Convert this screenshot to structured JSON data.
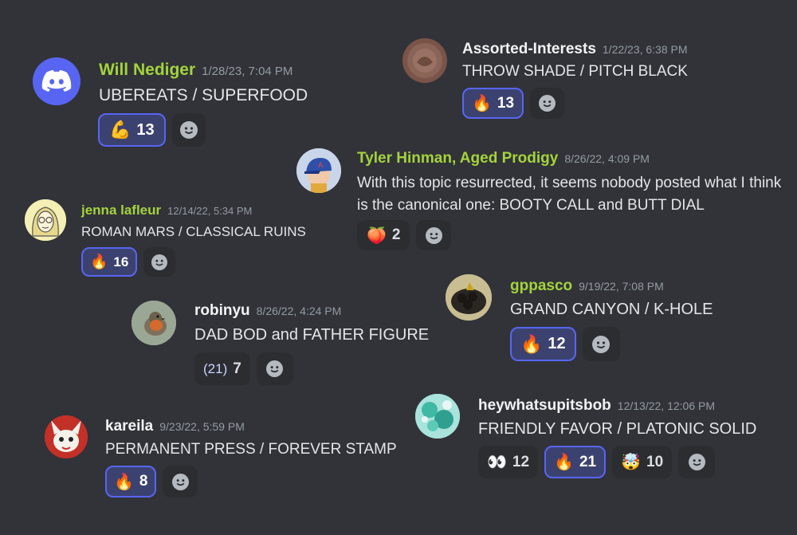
{
  "colors": {
    "background": "#313338",
    "name_green": "#a4d33c",
    "name_white": "#f2f3f5",
    "timestamp": "#949ba4",
    "reaction_me_border": "#5865f2",
    "reaction_me_bg": "#3c4270",
    "reaction_bg": "#2b2d31"
  },
  "messages": [
    {
      "id": "will",
      "author": "Will Nediger",
      "timestamp": "1/28/23, 7:04 PM",
      "text": "UBEREATS / SUPERFOOD",
      "avatar": "discord-logo-icon",
      "reactions": [
        {
          "emoji": "💪",
          "icon": "flexed-biceps-icon",
          "count": "13",
          "me": true
        }
      ]
    },
    {
      "id": "assorted",
      "author": "Assorted-Interests",
      "timestamp": "1/22/23, 6:38 PM",
      "text": "THROW SHADE / PITCH BLACK",
      "avatar": "coin-avatar",
      "reactions": [
        {
          "emoji": "🔥",
          "icon": "fire-icon",
          "count": "13",
          "me": true
        }
      ]
    },
    {
      "id": "tyler",
      "author": "Tyler Hinman, Aged Prodigy",
      "timestamp": "8/26/22, 4:09 PM",
      "text": "With this topic resurrected, it seems nobody posted what I think is the canonical one: BOOTY CALL and BUTT DIAL",
      "avatar": "baseball-cap-avatar",
      "reactions": [
        {
          "emoji": "🍑",
          "icon": "peach-icon",
          "count": "2",
          "me": false
        }
      ]
    },
    {
      "id": "jenna",
      "author": "jenna lafleur",
      "timestamp": "12/14/22, 5:34 PM",
      "text": "ROMAN MARS / CLASSICAL RUINS",
      "avatar": "drawn-face-avatar",
      "reactions": [
        {
          "emoji": "🔥",
          "icon": "fire-icon",
          "count": "16",
          "me": true
        }
      ]
    },
    {
      "id": "gppasco",
      "author": "gppasco",
      "timestamp": "9/19/22, 7:08 PM",
      "text": "GRAND CANYON / K-HOLE",
      "avatar": "cookies-bowl-avatar",
      "reactions": [
        {
          "emoji": "🔥",
          "icon": "fire-icon",
          "count": "12",
          "me": true
        }
      ]
    },
    {
      "id": "robinyu",
      "author": "robinyu",
      "timestamp": "8/26/22, 4:24 PM",
      "text": "DAD BOD and FATHER FIGURE",
      "avatar": "robin-bird-avatar",
      "reactions": [
        {
          "emoji": "(21)",
          "icon": "custom-21-emoji",
          "count": "7",
          "me": false
        }
      ]
    },
    {
      "id": "bob",
      "author": "heywhatsupitsbob",
      "timestamp": "12/13/22, 12:06 PM",
      "text": "FRIENDLY FAVOR / PLATONIC SOLID",
      "avatar": "splatter-avatar",
      "reactions": [
        {
          "emoji": "👀",
          "icon": "eyes-icon",
          "count": "12",
          "me": false
        },
        {
          "emoji": "🔥",
          "icon": "fire-icon",
          "count": "21",
          "me": true
        },
        {
          "emoji": "🤯",
          "icon": "exploding-head-icon",
          "count": "10",
          "me": false
        }
      ]
    },
    {
      "id": "kareila",
      "author": "kareila",
      "timestamp": "9/23/22, 5:59 PM",
      "text": "PERMANENT PRESS / FOREVER STAMP",
      "avatar": "fox-character-avatar",
      "reactions": [
        {
          "emoji": "🔥",
          "icon": "fire-icon",
          "count": "8",
          "me": true
        }
      ]
    }
  ]
}
